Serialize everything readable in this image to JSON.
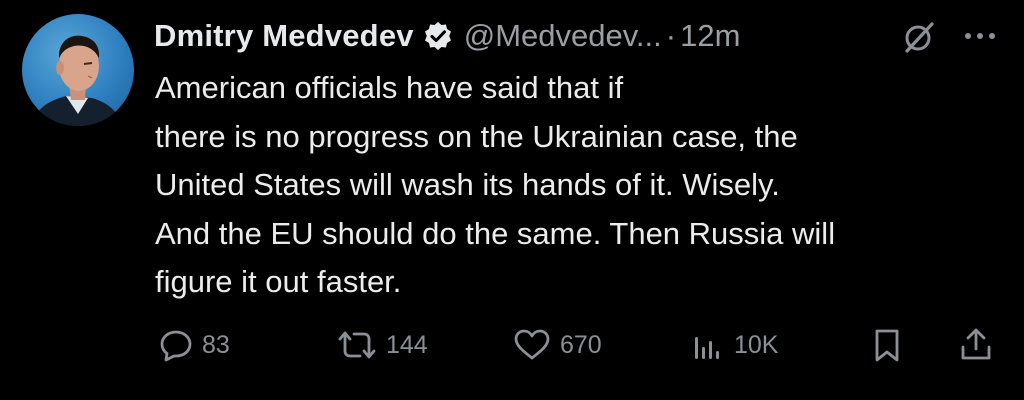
{
  "author": {
    "name": "Dmitry Medvedev",
    "handle": "@Medvedev...",
    "separator": "·",
    "time": "12m",
    "verified_icon": "verified-badge-icon"
  },
  "tweet": {
    "lines": [
      "American officials have said that if",
      "there is no progress on the Ukrainian case, the",
      "United States will wash its hands of it. Wisely.",
      "And the EU should do the same. Then Russia will",
      "figure it out faster."
    ]
  },
  "actions": {
    "replies": "83",
    "reposts": "144",
    "likes": "670",
    "views": "10K"
  },
  "colors": {
    "background": "#000000",
    "text": "#e7e9ea",
    "muted": "#8b9096",
    "verified": "#1d9bf0"
  }
}
